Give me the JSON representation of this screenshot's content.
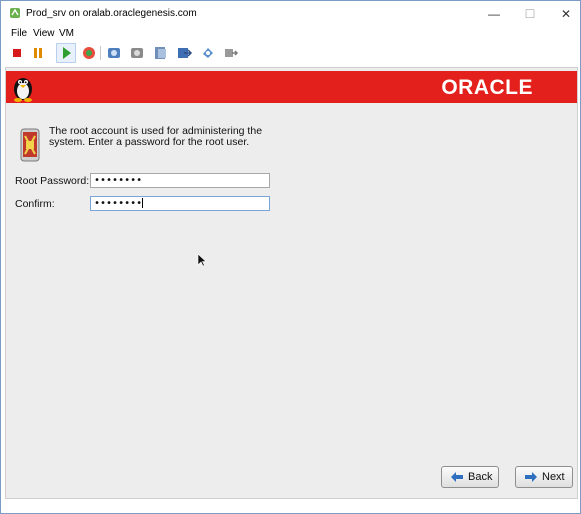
{
  "window": {
    "title": "Prod_srv on oralab.oraclegenesis.com",
    "controls": {
      "minimize": "—",
      "maximize": "☐",
      "close": "✕"
    }
  },
  "menu": {
    "items": [
      "File",
      "View",
      "VM"
    ]
  },
  "toolbar": {
    "buttons": [
      "stop-icon",
      "pause-icon",
      "play-icon",
      "refresh-icon",
      "snapshot-icon",
      "snapshot-manage-icon",
      "snapshot-revert-icon",
      "send-icon",
      "settings-icon",
      "transfer-icon"
    ]
  },
  "banner": {
    "logo": "ORACLE",
    "color": "#e3201b"
  },
  "installer": {
    "info_text": "The root account is used for administering the system.  Enter a password for the root user.",
    "root_password_label": "Root Password:",
    "root_password_value": "••••••••",
    "confirm_label": "Confirm:",
    "confirm_value": "••••••••"
  },
  "buttons": {
    "back": "Back",
    "next": "Next"
  }
}
